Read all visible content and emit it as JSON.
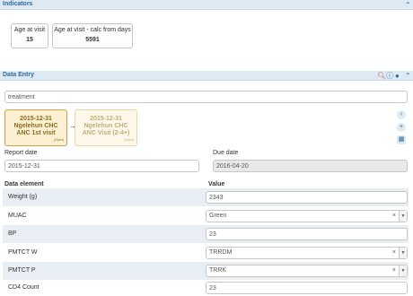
{
  "indicators": {
    "title": "Indicators",
    "items": [
      {
        "label": "Age at visit",
        "value": "15"
      },
      {
        "label": "Age at visit - calc from days",
        "value": "5591"
      }
    ]
  },
  "data_entry": {
    "title": "Data Entry",
    "program_stage_value": "treatment",
    "events": [
      {
        "date": "2015-12-31",
        "org_unit": "Ngelehun CHC",
        "stage": "ANC 1st visit",
        "status": "(Open)"
      },
      {
        "date": "2015-12-31",
        "org_unit": "Ngelehun CHC",
        "stage": "ANC Visit (2-4+)",
        "status": "(Open)"
      }
    ],
    "arrow": "→",
    "report_date_label": "Report date",
    "report_date_value": "2015-12-31",
    "due_date_label": "Due date",
    "due_date_value": "2016-04-20",
    "column_data_element": "Data element",
    "column_value": "Value",
    "rows": [
      {
        "label": "Weight (g)",
        "value": "2343"
      },
      {
        "label": "MUAC",
        "value": "Green"
      },
      {
        "label": "BP",
        "value": "23"
      },
      {
        "label": "PMTCT W",
        "value": "TRRDM"
      },
      {
        "label": "PMTCT P",
        "value": "TRRK"
      },
      {
        "label": "CD4 Count",
        "value": "23"
      }
    ]
  },
  "icons": {
    "collapse": "chevron-up-icon",
    "search": "search-icon",
    "info": "info-icon",
    "user": "user-icon",
    "back": "chevron-left-icon",
    "add": "plus-icon",
    "calendar": "calendar-icon",
    "clear": "clear-icon",
    "dropdown": "caret-down-icon"
  },
  "colors": {
    "header_bg": "#dde9f3",
    "header_text": "#2c6aa0",
    "active_card_bg": "#fbf1d2",
    "inactive_card_bg": "#fdf8e9",
    "row_band": "#e9eef5",
    "search_icon": "#d9534f"
  }
}
